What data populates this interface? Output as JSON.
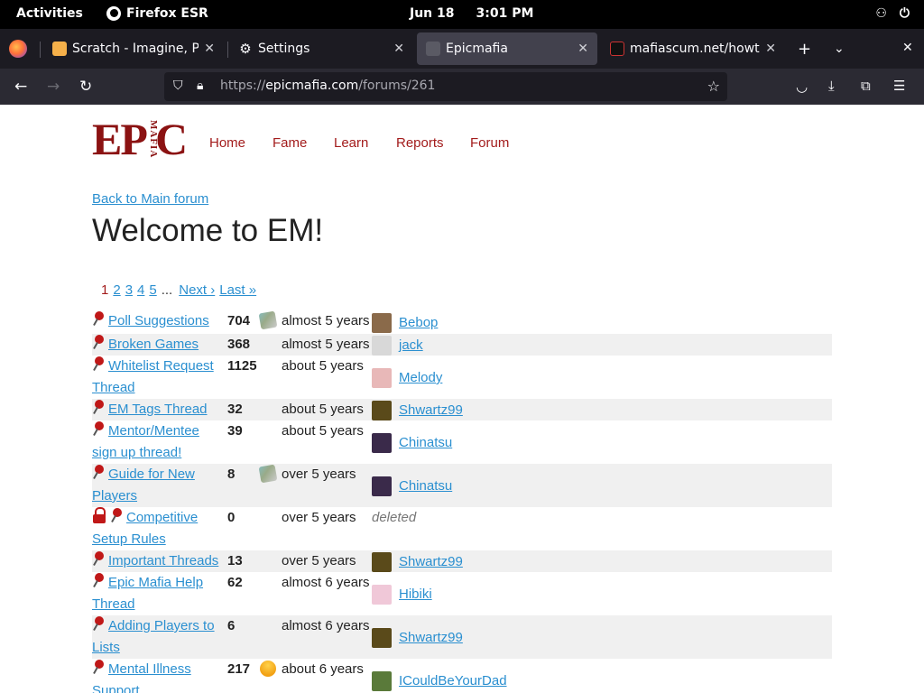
{
  "system_bar": {
    "activities": "Activities",
    "app_name": "Firefox ESR",
    "date": "Jun 18",
    "time": "3:01 PM"
  },
  "tabs": [
    {
      "label": "Scratch - Imagine, Prog",
      "icon": "scratch-icon",
      "active": false
    },
    {
      "label": "Settings",
      "icon": "gear-icon",
      "active": false
    },
    {
      "label": "Epicmafia",
      "icon": "epicmafia-icon",
      "active": true
    },
    {
      "label": "mafiascum.net/howto|",
      "icon": "mafiascum-icon",
      "active": false
    }
  ],
  "urlbar": {
    "proto": "https://",
    "host": "epicmafia.com",
    "path": "/forums/261"
  },
  "site_nav": {
    "logo_text": "EPIC",
    "logo_sub": "MAFIA",
    "items": [
      "Home",
      "Fame",
      "Learn",
      "Reports",
      "Forum"
    ]
  },
  "forum": {
    "back_link": "Back to Main forum",
    "title": "Welcome to EM!",
    "pager": {
      "current": "1",
      "pages": [
        "2",
        "3",
        "4",
        "5"
      ],
      "ellipsis": "...",
      "next": "Next ›",
      "last": "Last »"
    },
    "threads": [
      {
        "title": "Poll Suggestions",
        "count": "704",
        "mark": "clip",
        "age": "almost 5 years",
        "user": "Bebop",
        "avatar_color": "#8a6a4a",
        "locked": false,
        "lines": 1
      },
      {
        "title": "Broken Games",
        "count": "368",
        "mark": "",
        "age": "almost 5 years",
        "user": "jack",
        "avatar_color": "#d8d8d8",
        "locked": false,
        "lines": 1
      },
      {
        "title": "Whitelist Request Thread",
        "count": "1125",
        "mark": "",
        "age": "about 5 years",
        "user": "Melody",
        "avatar_color": "#e8b8b8",
        "locked": false,
        "lines": 2
      },
      {
        "title": "EM Tags Thread",
        "count": "32",
        "mark": "",
        "age": "about 5 years",
        "user": "Shwartz99",
        "avatar_color": "#5a4a1a",
        "locked": false,
        "lines": 1
      },
      {
        "title": "Mentor/Mentee sign up thread!",
        "count": "39",
        "mark": "",
        "age": "about 5 years",
        "user": "Chinatsu",
        "avatar_color": "#3a2a4a",
        "locked": false,
        "lines": 2
      },
      {
        "title": "Guide for New Players",
        "count": "8",
        "mark": "clip",
        "age": "over 5 years",
        "user": "Chinatsu",
        "avatar_color": "#3a2a4a",
        "locked": false,
        "lines": 2
      },
      {
        "title": "Competitive Setup Rules",
        "count": "0",
        "mark": "",
        "age": "over 5 years",
        "user": "deleted",
        "avatar_color": "",
        "locked": true,
        "lines": 2
      },
      {
        "title": "Important Threads",
        "count": "13",
        "mark": "",
        "age": "over 5 years",
        "user": "Shwartz99",
        "avatar_color": "#5a4a1a",
        "locked": false,
        "lines": 1
      },
      {
        "title": "Epic Mafia Help Thread",
        "count": "62",
        "mark": "",
        "age": "almost 6 years",
        "user": "Hibiki",
        "avatar_color": "#f0c8d8",
        "locked": false,
        "lines": 2
      },
      {
        "title": "Adding Players to Lists",
        "count": "6",
        "mark": "",
        "age": "almost 6 years",
        "user": "Shwartz99",
        "avatar_color": "#5a4a1a",
        "locked": false,
        "lines": 2
      },
      {
        "title": "Mental Illness Support",
        "count": "217",
        "mark": "sun",
        "age": "about 6 years",
        "user": "ICouldBeYourDad",
        "avatar_color": "#5a7a3a",
        "locked": false,
        "lines": 2
      }
    ]
  }
}
